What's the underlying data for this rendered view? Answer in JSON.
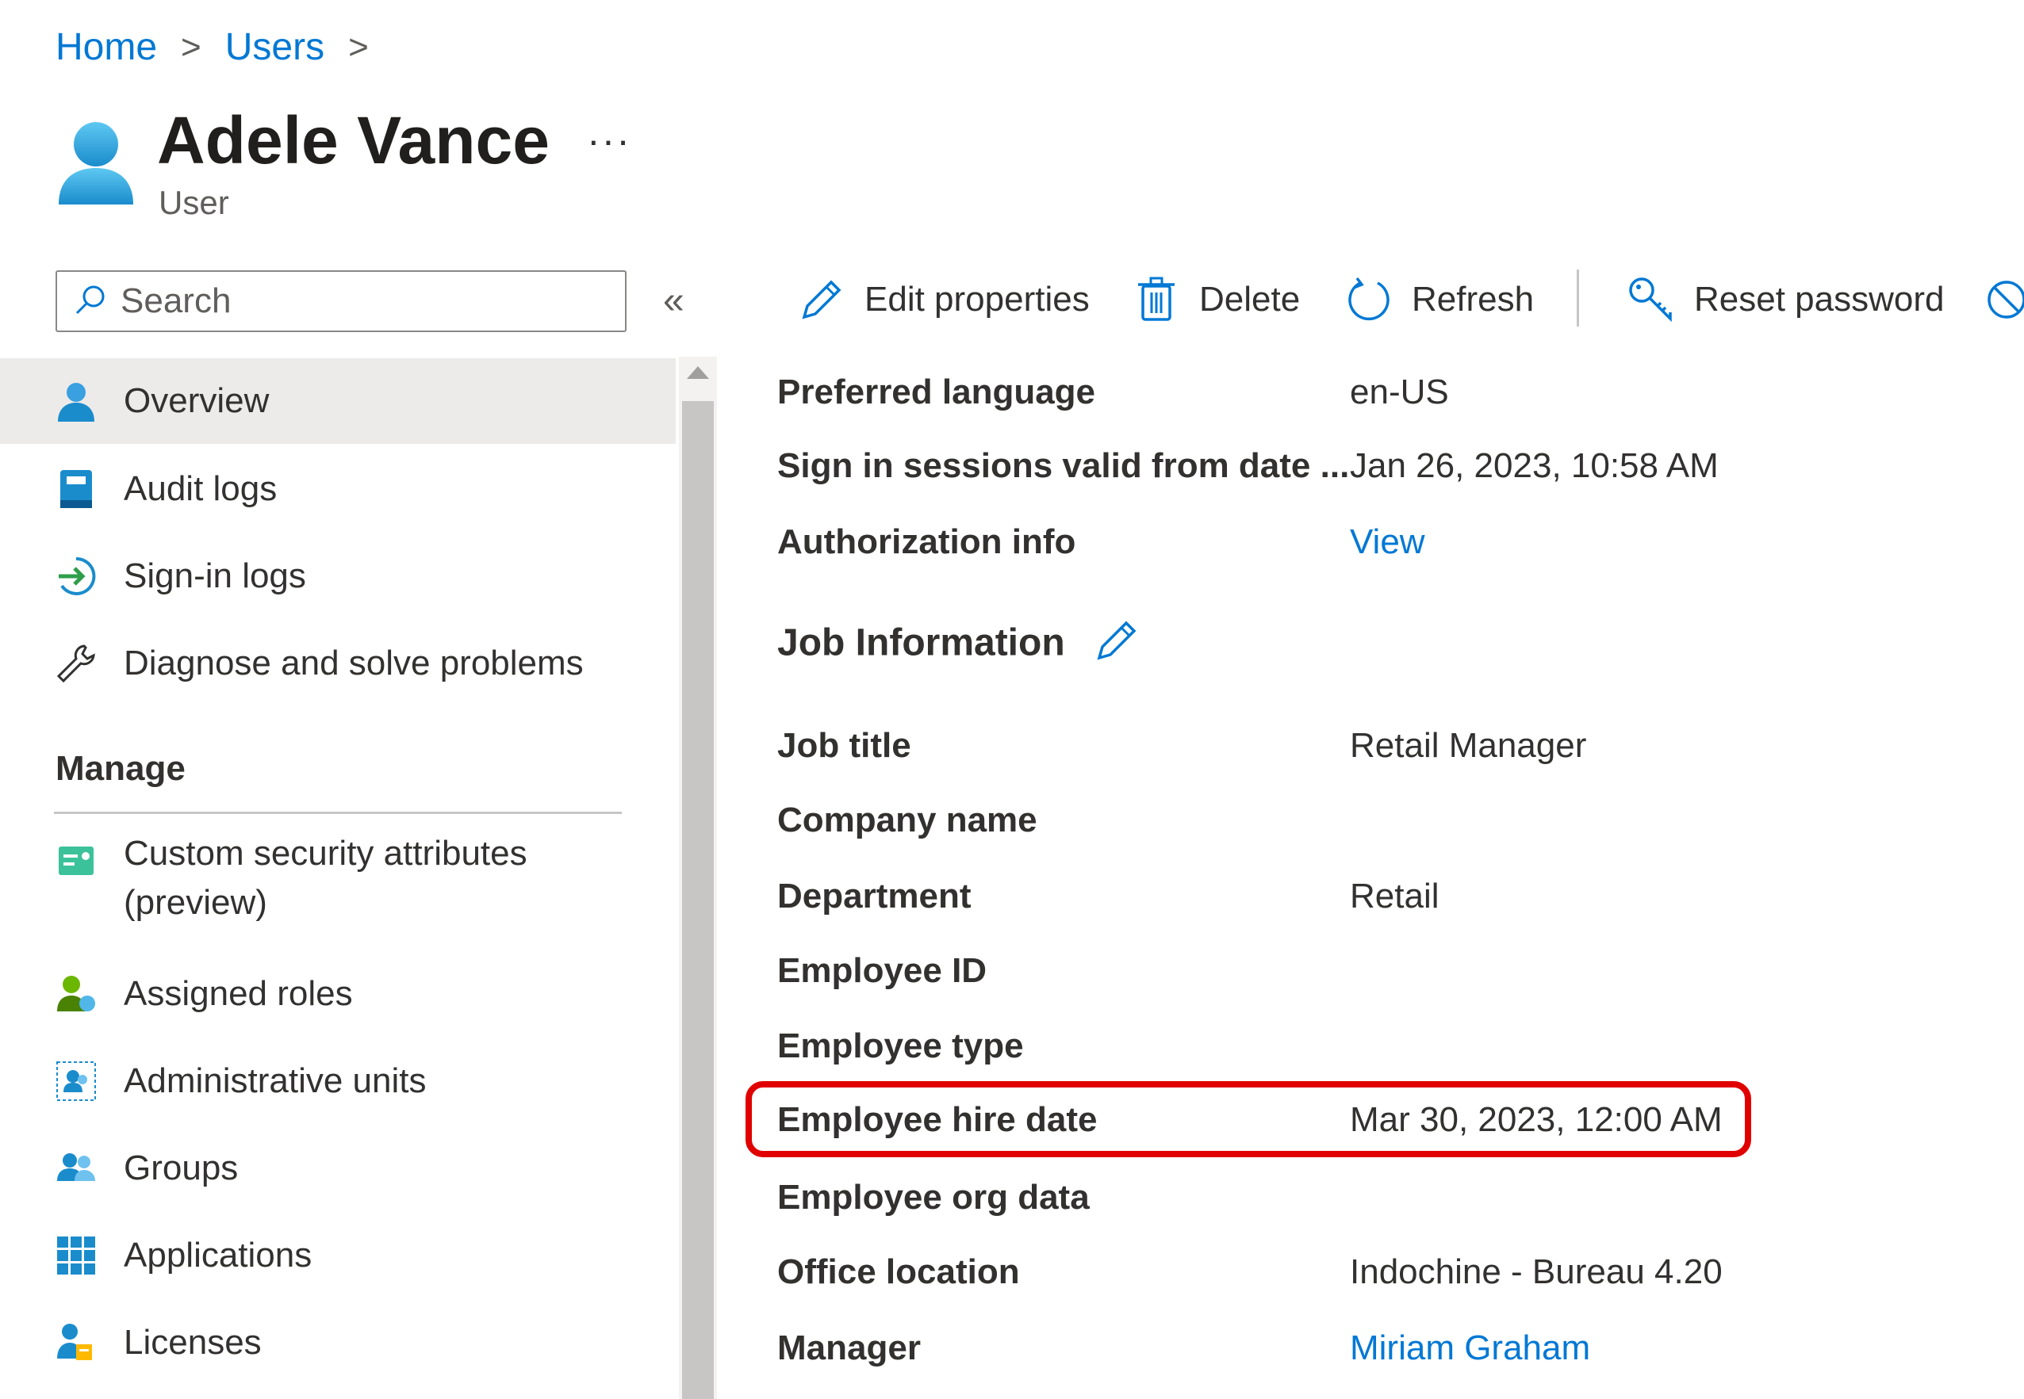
{
  "breadcrumb": {
    "items": [
      "Home",
      "Users"
    ],
    "separator": ">"
  },
  "header": {
    "title": "Adele Vance",
    "subtitle": "User",
    "more": "···"
  },
  "search": {
    "placeholder": "Search"
  },
  "collapse_glyph": "«",
  "sidebar": {
    "items": [
      {
        "label": "Overview",
        "icon": "user-icon",
        "active": true
      },
      {
        "label": "Audit logs",
        "icon": "audit-log-icon"
      },
      {
        "label": "Sign-in logs",
        "icon": "sign-in-icon"
      },
      {
        "label": "Diagnose and solve problems",
        "icon": "wrench-icon"
      }
    ],
    "manage_heading": "Manage",
    "manage_items": [
      {
        "label": "Custom security attributes",
        "label2": "(preview)",
        "icon": "security-attributes-icon"
      },
      {
        "label": "Assigned roles",
        "icon": "assigned-roles-icon"
      },
      {
        "label": "Administrative units",
        "icon": "admin-units-icon"
      },
      {
        "label": "Groups",
        "icon": "groups-icon"
      },
      {
        "label": "Applications",
        "icon": "applications-icon"
      },
      {
        "label": "Licenses",
        "icon": "licenses-icon"
      }
    ]
  },
  "toolbar": {
    "edit": "Edit properties",
    "delete": "Delete",
    "refresh": "Refresh",
    "reset": "Reset password"
  },
  "details": {
    "preferred_language": {
      "label": "Preferred language",
      "value": "en-US"
    },
    "sign_in_sessions": {
      "label": "Sign in sessions valid from date ...",
      "value": "Jan 26, 2023, 10:58 AM"
    },
    "authorization": {
      "label": "Authorization info",
      "value": "View"
    },
    "job_section": "Job Information",
    "job_title": {
      "label": "Job title",
      "value": "Retail Manager"
    },
    "company_name": {
      "label": "Company name",
      "value": ""
    },
    "department": {
      "label": "Department",
      "value": "Retail"
    },
    "employee_id": {
      "label": "Employee ID",
      "value": ""
    },
    "employee_type": {
      "label": "Employee type",
      "value": ""
    },
    "hire_date": {
      "label": "Employee hire date",
      "value": "Mar 30, 2023, 12:00 AM"
    },
    "org_data": {
      "label": "Employee org data",
      "value": ""
    },
    "office_location": {
      "label": "Office location",
      "value": "Indochine - Bureau 4.20"
    },
    "manager": {
      "label": "Manager",
      "value": "Miriam Graham"
    }
  },
  "colors": {
    "accent": "#0078d4",
    "highlight": "#e00000",
    "active_bg": "#edebe9"
  }
}
